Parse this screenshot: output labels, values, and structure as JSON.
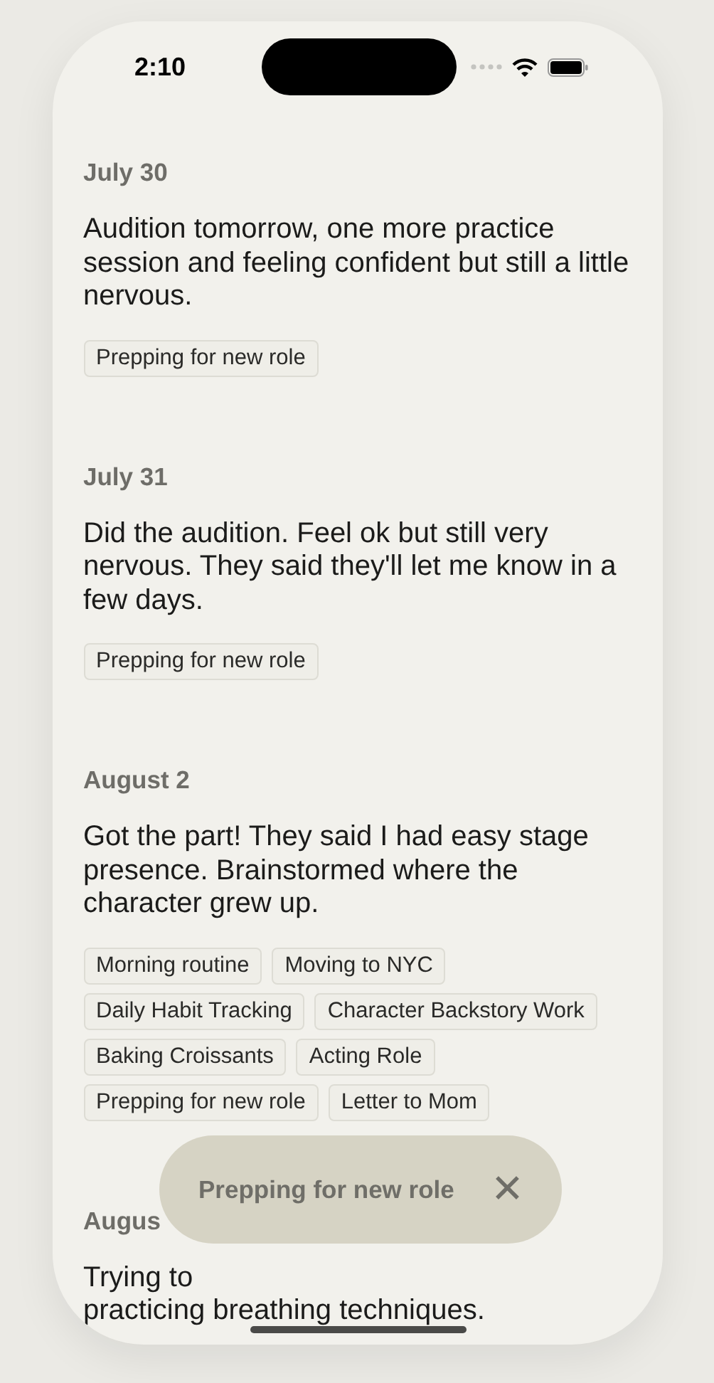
{
  "status_bar": {
    "time": "2:10"
  },
  "entries": [
    {
      "date": "July 30",
      "text": "Audition tomorrow, one more practice session and feeling confident but still a little nervous.",
      "tags": [
        "Prepping for new role"
      ]
    },
    {
      "date": "July 31",
      "text": "Did the audition. Feel ok but still very nervous. They said they'll let me know in a few days.",
      "tags": [
        "Prepping for new role"
      ]
    },
    {
      "date": "August 2",
      "text": "Got the part! They said I had easy stage presence. Brainstormed where the character grew up.",
      "tags": [
        "Morning routine",
        "Moving to NYC",
        "Daily Habit Tracking",
        "Character Backstory Work",
        "Baking Croissants",
        "Acting Role",
        "Prepping for new role",
        "Letter to Mom"
      ]
    },
    {
      "date": "Augus",
      "text": "Trying to",
      "text_continued": "practicing breathing techniques."
    }
  ],
  "filter_toast": {
    "label": "Prepping for new role",
    "close": "✕"
  }
}
